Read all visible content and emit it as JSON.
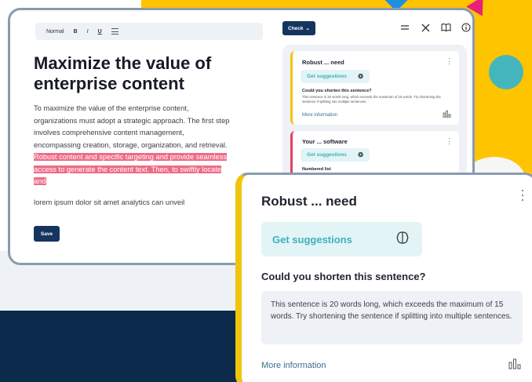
{
  "colors": {
    "navy": "#15355e",
    "yellow": "#ffc400",
    "teal": "#3bb2bc",
    "highlight": "#ee6b86",
    "warning_bar": "#f2c40b",
    "error_bar": "#e6405f"
  },
  "toolbar": {
    "style_label": "Normal",
    "bold_label": "B",
    "italic_label": "I",
    "underline_label": "U"
  },
  "document": {
    "title": "Maximize the value of enterprise content",
    "body_plain": "To maximize the value of the enterprise content, organizations must adopt a strategic approach. The first step involves comprehensive content management, encompassing creation, storage, organization, and retrieval. ",
    "body_highlight": "Robust content and specific targeting and provide seamless access to generate the content text. Then, to swiftly locate and",
    "lorem": "lorem ipsum dolor sit amet analytics can unveil",
    "save_label": "Save"
  },
  "panel": {
    "check_label": "Check",
    "check_caret": "⌄",
    "header_icons": [
      "menu-icon",
      "close-icon",
      "book-icon",
      "info-icon"
    ],
    "cards": [
      {
        "title": "Robust ... need",
        "button": "Get suggestions",
        "question": "Could you shorten this sentence?",
        "description": "This sentence is 20 words long, which exceeds the maximum of 15 words. Try shortening the sentence if splitting into multiple sentences.",
        "more": "More information"
      },
      {
        "title": "Your ... software",
        "button": "Get suggestions",
        "subtitle": "Numbered list"
      }
    ]
  },
  "zoom": {
    "title": "Robust ... need",
    "button": "Get suggestions",
    "question": "Could you shorten this sentence?",
    "description": "This sentence is 20 words long, which exceeds the maximum of 15 words. Try shortening the sentence if splitting into multiple sentences.",
    "more": "More information"
  }
}
